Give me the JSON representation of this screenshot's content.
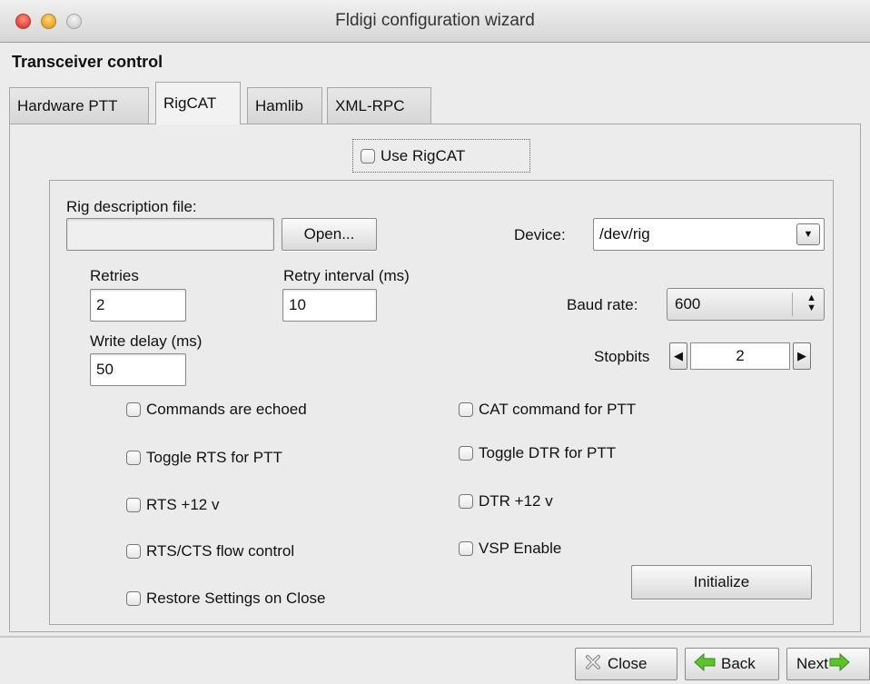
{
  "window": {
    "title": "Fldigi configuration wizard"
  },
  "section_title": "Transceiver control",
  "tabs": [
    {
      "label": "Hardware PTT",
      "active": false
    },
    {
      "label": "RigCAT",
      "active": true
    },
    {
      "label": "Hamlib",
      "active": false
    },
    {
      "label": "XML-RPC",
      "active": false
    }
  ],
  "use_rigcat": {
    "label": "Use RigCAT",
    "checked": false
  },
  "rig_description": {
    "label": "Rig description file:",
    "value": "",
    "open_label": "Open..."
  },
  "device": {
    "label": "Device:",
    "value": "/dev/rig"
  },
  "retries": {
    "label": "Retries",
    "value": "2"
  },
  "retry_interval": {
    "label": "Retry interval (ms)",
    "value": "10"
  },
  "write_delay": {
    "label": "Write delay (ms)",
    "value": "50"
  },
  "baud_rate": {
    "label": "Baud rate:",
    "value": "600"
  },
  "stopbits": {
    "label": "Stopbits",
    "value": "2"
  },
  "checkboxes_left": [
    {
      "label": "Commands are echoed",
      "checked": false
    },
    {
      "label": "Toggle RTS for PTT",
      "checked": false
    },
    {
      "label": "RTS +12 v",
      "checked": false
    },
    {
      "label": "RTS/CTS flow control",
      "checked": false
    },
    {
      "label": "Restore Settings on Close",
      "checked": false
    }
  ],
  "checkboxes_right": [
    {
      "label": "CAT command for PTT",
      "checked": false
    },
    {
      "label": "Toggle DTR for PTT",
      "checked": false
    },
    {
      "label": "DTR +12 v",
      "checked": false
    },
    {
      "label": "VSP Enable",
      "checked": false
    }
  ],
  "initialize_label": "Initialize",
  "nav": {
    "close": "Close",
    "back": "Back",
    "next": "Next"
  },
  "colors": {
    "window_bg": "#ececec",
    "arrow_green": "#5cc42b"
  }
}
